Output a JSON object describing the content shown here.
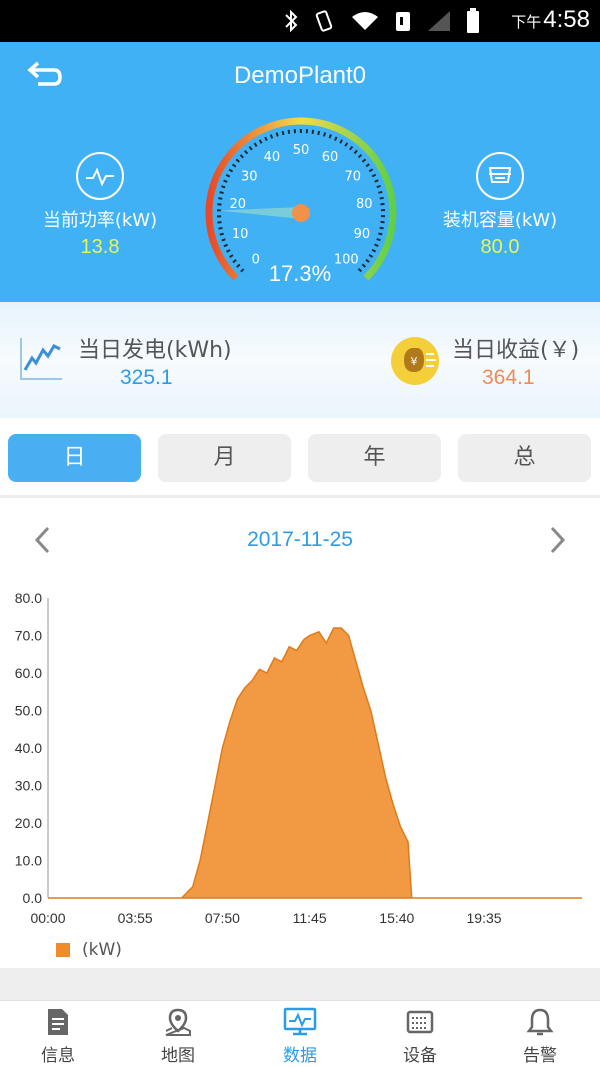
{
  "status_bar": {
    "time_prefix": "下午",
    "time": "4:58"
  },
  "header": {
    "title": "DemoPlant0",
    "current_power": {
      "label": "当前功率(kW)",
      "value": "13.8"
    },
    "capacity": {
      "label": "装机容量(kW)",
      "value": "80.0"
    },
    "gauge": {
      "percent_text": "17.3%",
      "percent": 17.3,
      "ticks": [
        "0",
        "10",
        "20",
        "30",
        "40",
        "50",
        "60",
        "70",
        "80",
        "90",
        "100"
      ]
    }
  },
  "daily": {
    "generation": {
      "label": "当日发电(kWh)",
      "value": "325.1"
    },
    "income": {
      "label": "当日收益(￥)",
      "value": "364.1"
    }
  },
  "tabs": [
    {
      "label": "日",
      "active": true
    },
    {
      "label": "月",
      "active": false
    },
    {
      "label": "年",
      "active": false
    },
    {
      "label": "总",
      "active": false
    }
  ],
  "date_nav": {
    "date": "2017-11-25"
  },
  "chart_data": {
    "type": "area",
    "series": [
      {
        "name": "(kW)",
        "color": "#f08b2a",
        "points": [
          [
            "00:00",
            0
          ],
          [
            "06:00",
            0
          ],
          [
            "06:30",
            3
          ],
          [
            "06:50",
            10
          ],
          [
            "07:10",
            20
          ],
          [
            "07:30",
            30
          ],
          [
            "07:50",
            40
          ],
          [
            "08:10",
            47
          ],
          [
            "08:30",
            53
          ],
          [
            "08:50",
            56
          ],
          [
            "09:10",
            58
          ],
          [
            "09:30",
            61
          ],
          [
            "09:50",
            60
          ],
          [
            "10:10",
            64
          ],
          [
            "10:30",
            63
          ],
          [
            "10:50",
            67
          ],
          [
            "11:10",
            66
          ],
          [
            "11:30",
            69
          ],
          [
            "11:45",
            70
          ],
          [
            "12:10",
            71
          ],
          [
            "12:30",
            68
          ],
          [
            "12:50",
            72
          ],
          [
            "13:10",
            72
          ],
          [
            "13:30",
            70
          ],
          [
            "13:50",
            63
          ],
          [
            "14:10",
            56
          ],
          [
            "14:30",
            50
          ],
          [
            "14:50",
            41
          ],
          [
            "15:10",
            32
          ],
          [
            "15:30",
            25
          ],
          [
            "15:50",
            19
          ],
          [
            "16:10",
            15
          ],
          [
            "16:20",
            0
          ],
          [
            "23:59",
            0
          ]
        ]
      }
    ],
    "x_ticks": [
      "00:00",
      "03:55",
      "07:50",
      "11:45",
      "15:40",
      "19:35"
    ],
    "y_ticks": [
      "0.0",
      "10.0",
      "20.0",
      "30.0",
      "40.0",
      "50.0",
      "60.0",
      "70.0",
      "80.0"
    ],
    "ylim": [
      0,
      80
    ],
    "xlim": [
      "00:00",
      "23:59"
    ],
    "legend": "bottom-left",
    "grid": false
  },
  "bottom_nav": [
    {
      "label": "信息",
      "icon": "document-icon",
      "active": false
    },
    {
      "label": "地图",
      "icon": "map-pin-icon",
      "active": false
    },
    {
      "label": "数据",
      "icon": "monitor-chart-icon",
      "active": true
    },
    {
      "label": "设备",
      "icon": "device-icon",
      "active": false
    },
    {
      "label": "告警",
      "icon": "bell-icon",
      "active": false
    }
  ]
}
